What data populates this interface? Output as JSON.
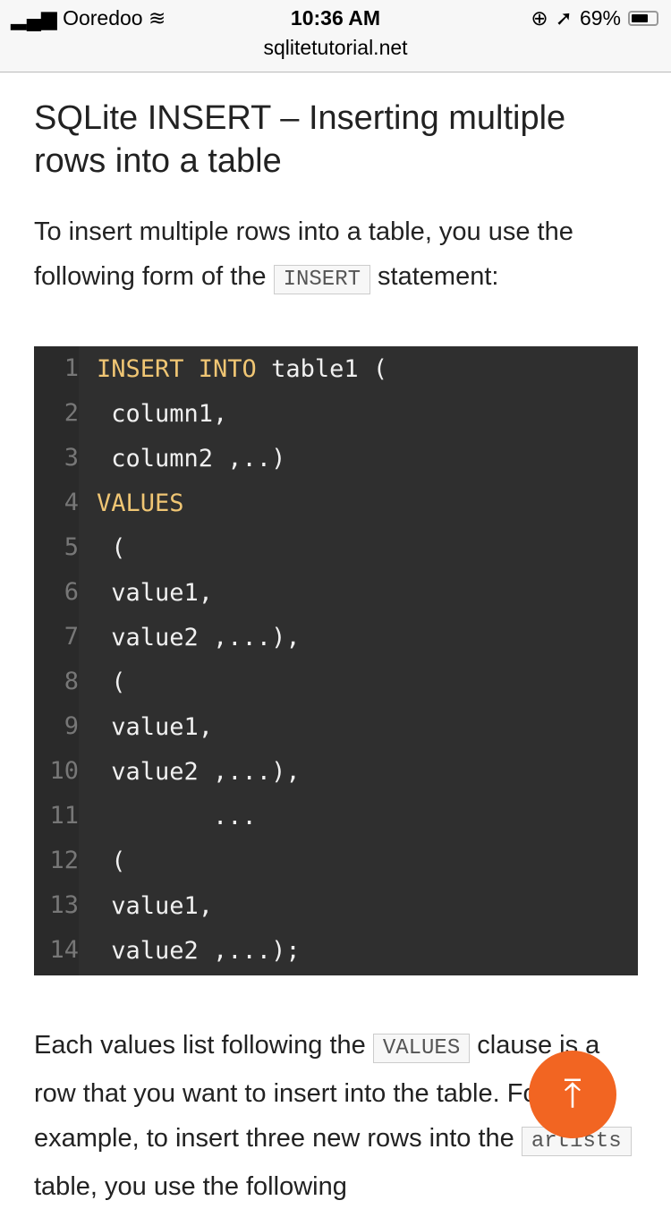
{
  "status": {
    "carrier": "Ooredoo",
    "time": "10:36 AM",
    "battery": "69%",
    "battery_level": 0.69,
    "url": "sqlitetutorial.net"
  },
  "article": {
    "title": "SQLite INSERT – Inserting multiple rows into a table",
    "p1_a": "To insert multiple rows into a table, you use the following form of the ",
    "p1_code": "INSERT",
    "p1_b": " statement:",
    "code_lines": [
      {
        "n": "1",
        "kw": "INSERT INTO",
        "text": " table1 ("
      },
      {
        "n": "2",
        "kw": "",
        "text": " column1,"
      },
      {
        "n": "3",
        "kw": "",
        "text": " column2 ,..)"
      },
      {
        "n": "4",
        "kw": "VALUES",
        "text": ""
      },
      {
        "n": "5",
        "kw": "",
        "text": " ("
      },
      {
        "n": "6",
        "kw": "",
        "text": " value1,"
      },
      {
        "n": "7",
        "kw": "",
        "text": " value2 ,...),"
      },
      {
        "n": "8",
        "kw": "",
        "text": " ("
      },
      {
        "n": "9",
        "kw": "",
        "text": " value1,"
      },
      {
        "n": "10",
        "kw": "",
        "text": " value2 ,...),"
      },
      {
        "n": "11",
        "kw": "",
        "text": "        ..."
      },
      {
        "n": "12",
        "kw": "",
        "text": " ("
      },
      {
        "n": "13",
        "kw": "",
        "text": " value1,"
      },
      {
        "n": "14",
        "kw": "",
        "text": " value2 ,...);"
      }
    ],
    "p2_a": "Each values list following the ",
    "p2_code": "VALUES",
    "p2_b": " clause is a row that you want to insert into the table. For example, to insert three new rows into the ",
    "p2_code2": "artists",
    "p2_c": " table, you use the following"
  },
  "back_to_top": "⤒"
}
